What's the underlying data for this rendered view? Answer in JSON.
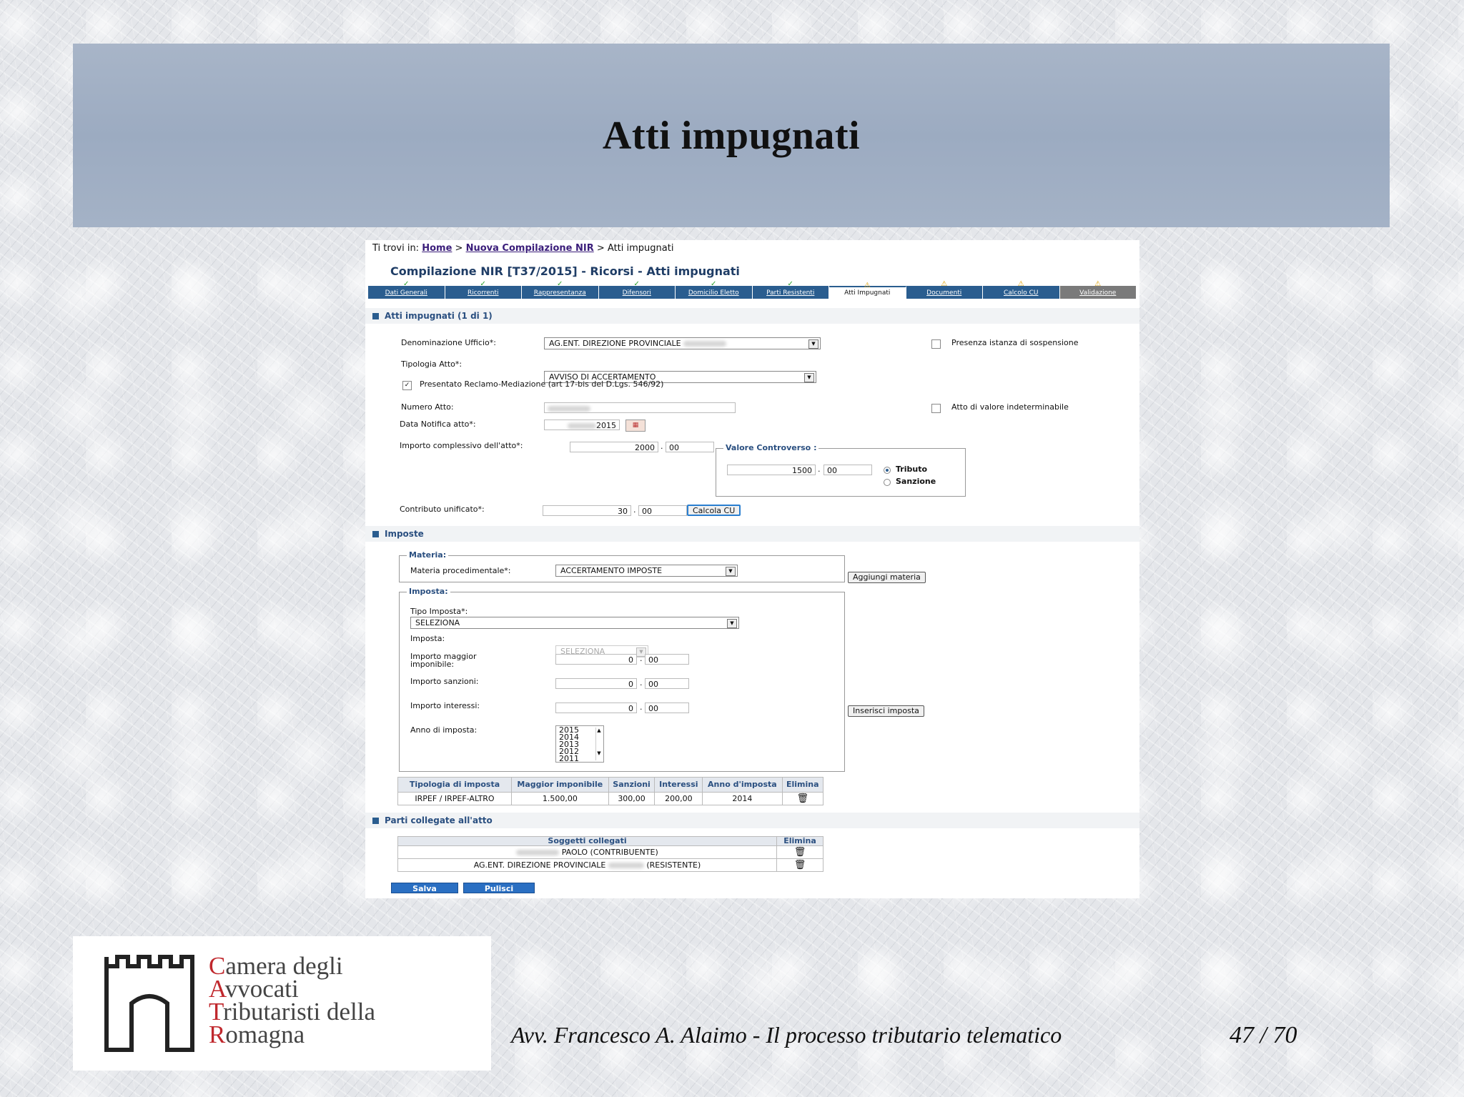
{
  "slide": {
    "title": "Atti impugnati",
    "footer": "Avv. Francesco A. Alaimo - Il processo tributario telematico",
    "page": "47 / 70"
  },
  "logo": {
    "lines": [
      {
        "initial": "C",
        "rest": "amera degli"
      },
      {
        "initial": "A",
        "rest": "vvocati"
      },
      {
        "initial": "T",
        "rest": "ributaristi della"
      },
      {
        "initial": "R",
        "rest": "omagna"
      }
    ],
    "accent": "#c0282d"
  },
  "app": {
    "breadcrumb": {
      "prefix": "Ti trovi in:",
      "home": "Home",
      "sep1": ">",
      "step": "Nuova Compilazione NIR",
      "sep2": ">",
      "current": "Atti impugnati"
    },
    "page_title": "Compilazione NIR [T37/2015] - Ricorsi - Atti impugnati",
    "tabs": [
      {
        "label": "Dati Generali",
        "mark": "✓"
      },
      {
        "label": "Ricorrenti",
        "mark": "✓"
      },
      {
        "label": "Rappresentanza",
        "mark": "✓"
      },
      {
        "label": "Difensori",
        "mark": "✓"
      },
      {
        "label": "Domicilio Eletto",
        "mark": "✓"
      },
      {
        "label": "Parti Resistenti",
        "mark": "✓"
      },
      {
        "label": "Atti Impugnati",
        "mark": "⚠"
      },
      {
        "label": "Documenti",
        "mark": "⚠"
      },
      {
        "label": "Calcolo CU",
        "mark": "⚠"
      },
      {
        "label": "Validazione",
        "mark": "⚠"
      }
    ],
    "atti": {
      "section": "Atti impugnati (1 di 1)",
      "ufficio_label": "Denominazione Ufficio*:",
      "ufficio_value": "AG.ENT. DIREZIONE PROVINCIALE",
      "sospensione_label": "Presenza istanza di sospensione",
      "tipologia_label": "Tipologia Atto*:",
      "tipologia_value": "AVVISO DI ACCERTAMENTO",
      "reclamo_label": "Presentato Reclamo-Mediazione (art 17-bis del D.Lgs. 546/92)",
      "numero_label": "Numero Atto:",
      "indeterminabile_label": "Atto di valore indeterminabile",
      "data_label": "Data Notifica atto*:",
      "data_value": "2015",
      "importo_label": "Importo complessivo dell'atto*:",
      "importo_int": "2000",
      "importo_dec": "00",
      "controverso_legend": "Valore Controverso :",
      "controverso_int": "1500",
      "controverso_dec": "00",
      "tributo_label": "Tributo",
      "sanzione_label": "Sanzione",
      "contributo_label": "Contributo unificato*:",
      "contributo_int": "30",
      "contributo_dec": "00",
      "calcola_button": "Calcola CU",
      "dot": "."
    },
    "imposte": {
      "section": "Imposte",
      "materia_legend": "Materia:",
      "materia_label": "Materia procedimentale*:",
      "materia_value": "ACCERTAMENTO IMPOSTE",
      "aggiungi_button": "Aggiungi materia",
      "imposta_legend": "Imposta:",
      "tipo_label": "Tipo Imposta*:",
      "tipo_value": "SELEZIONA",
      "imposta_label": "Imposta:",
      "imposta_value": "SELEZIONA",
      "maggior_label": "Importo maggior imponibile:",
      "maggior_int": "0",
      "maggior_dec": "00",
      "sanzioni_label": "Importo sanzioni:",
      "sanzioni_int": "0",
      "sanzioni_dec": "00",
      "interessi_label": "Importo interessi:",
      "interessi_int": "0",
      "interessi_dec": "00",
      "anno_label": "Anno di imposta:",
      "anni": [
        "2015",
        "2014",
        "2013",
        "2012",
        "2011"
      ],
      "inserisci_button": "Inserisci imposta",
      "table_headers": [
        "Tipologia di imposta",
        "Maggior imponibile",
        "Sanzioni",
        "Interessi",
        "Anno d'imposta",
        "Elimina"
      ],
      "rows": [
        {
          "tipologia": "IRPEF / IRPEF-ALTRO",
          "maggior": "1.500,00",
          "sanzioni": "300,00",
          "interessi": "200,00",
          "anno": "2014"
        }
      ]
    },
    "parti": {
      "section": "Parti collegate all'atto",
      "headers": [
        "Soggetti collegati",
        "Elimina"
      ],
      "rows": [
        {
          "nome": "PAOLO (CONTRIBUENTE)"
        },
        {
          "nome": "AG.ENT. DIREZIONE PROVINCIALE",
          "ruolo": "(RESISTENTE)"
        }
      ]
    },
    "actions": {
      "salva": "Salva",
      "pulisci": "Pulisci"
    }
  }
}
